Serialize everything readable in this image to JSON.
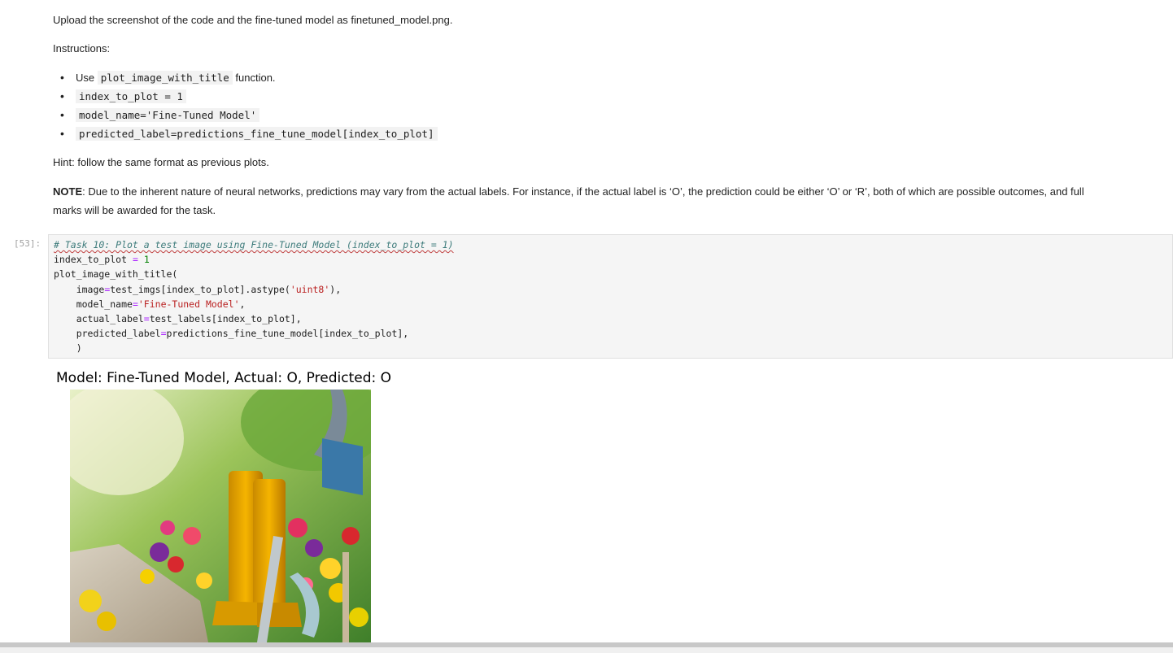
{
  "intro": "Upload the screenshot of the code and the fine-tuned model as finetuned_model.png.",
  "instructions_label": "Instructions:",
  "instructions": [
    {
      "prefix": "Use ",
      "code": "plot_image_with_title",
      "suffix": " function."
    },
    {
      "prefix": "",
      "code": "index_to_plot = 1",
      "suffix": ""
    },
    {
      "prefix": "",
      "code": "model_name='Fine-Tuned Model'",
      "suffix": ""
    },
    {
      "prefix": "",
      "code": "predicted_label=predictions_fine_tune_model[index_to_plot]",
      "suffix": ""
    }
  ],
  "hint": "Hint: follow the same format as previous plots.",
  "note_label": "NOTE",
  "note_text_line1": ": Due to the inherent nature of neural networks, predictions may vary from the actual labels. For instance, if the actual label is ‘O’, the prediction could be either ‘O’ or ‘R’, both of which are possible outcomes, and full",
  "note_text_line2": "marks will be awarded for the task.",
  "cell": {
    "prompt": "[53]:",
    "comment": "# Task 10: Plot a test image using Fine-Tuned Model (index_to_plot = 1)",
    "line2_var": "index_to_plot ",
    "line2_op": "=",
    "line2_num": "1",
    "line3": "plot_image_with_title(",
    "line4_a": "    image",
    "line4_b": "test_imgs[index_to_plot].astype(",
    "line4_str": "'uint8'",
    "line4_c": "),",
    "line5_a": "    model_name",
    "line5_str": "'Fine-Tuned Model'",
    "line5_c": ",",
    "line6_a": "    actual_label",
    "line6_b": "test_labels[index_to_plot],",
    "line7_a": "    predicted_label",
    "line7_b": "predictions_fine_tune_model[index_to_plot],",
    "line8": "    )"
  },
  "output": {
    "title": "Model: Fine-Tuned Model, Actual: O, Predicted: O"
  }
}
